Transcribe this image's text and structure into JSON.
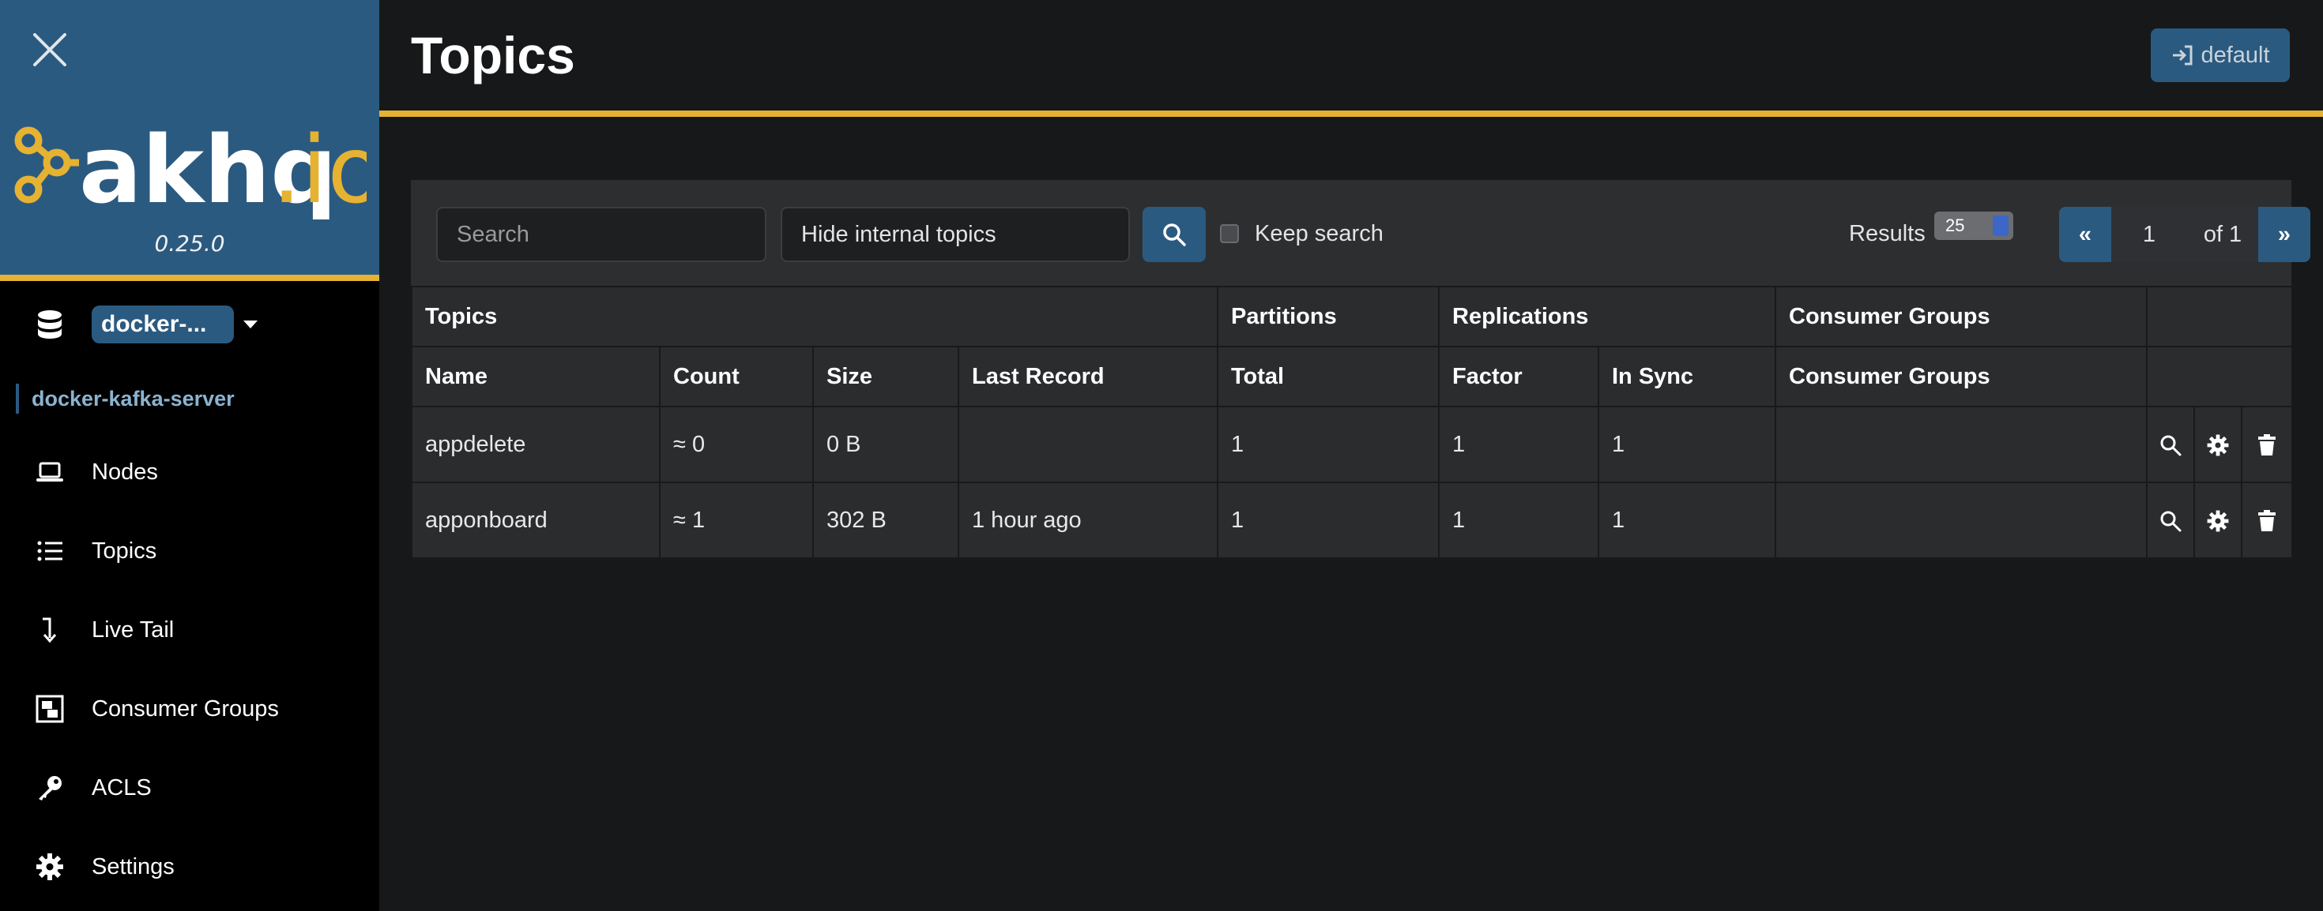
{
  "sidebar": {
    "version": "0.25.0",
    "cluster_selector": "docker-...",
    "cluster_name": "docker-kafka-server",
    "items": [
      {
        "label": "Nodes",
        "icon": "laptop-icon"
      },
      {
        "label": "Topics",
        "icon": "list-icon"
      },
      {
        "label": "Live Tail",
        "icon": "level-down-icon"
      },
      {
        "label": "Consumer Groups",
        "icon": "object-group-icon"
      },
      {
        "label": "ACLS",
        "icon": "key-icon"
      },
      {
        "label": "Settings",
        "icon": "gear-icon"
      }
    ]
  },
  "header": {
    "title": "Topics",
    "login_label": "default"
  },
  "toolbar": {
    "search_placeholder": "Search",
    "topic_filter": "Hide internal topics",
    "keep_search_label": "Keep search",
    "results_label": "Results",
    "results_per_page": "25",
    "pager": {
      "prev": "«",
      "page": "1",
      "of": "of 1",
      "next": "»"
    }
  },
  "table": {
    "groups": [
      "Topics",
      "Partitions",
      "Replications",
      "Consumer Groups"
    ],
    "columns": [
      "Name",
      "Count",
      "Size",
      "Last Record",
      "Total",
      "Factor",
      "In Sync",
      "Consumer Groups"
    ],
    "rows": [
      {
        "name": "appdelete",
        "count": "≈ 0",
        "size": "0 B",
        "last_record": "",
        "total": "1",
        "factor": "1",
        "in_sync": "1",
        "consumer_groups": ""
      },
      {
        "name": "apponboard",
        "count": "≈ 1",
        "size": "302 B",
        "last_record": "1 hour ago",
        "total": "1",
        "factor": "1",
        "in_sync": "1",
        "consumer_groups": ""
      }
    ]
  },
  "colors": {
    "brand": "#2b5a80",
    "accent": "#e6b232",
    "background": "#171819"
  }
}
